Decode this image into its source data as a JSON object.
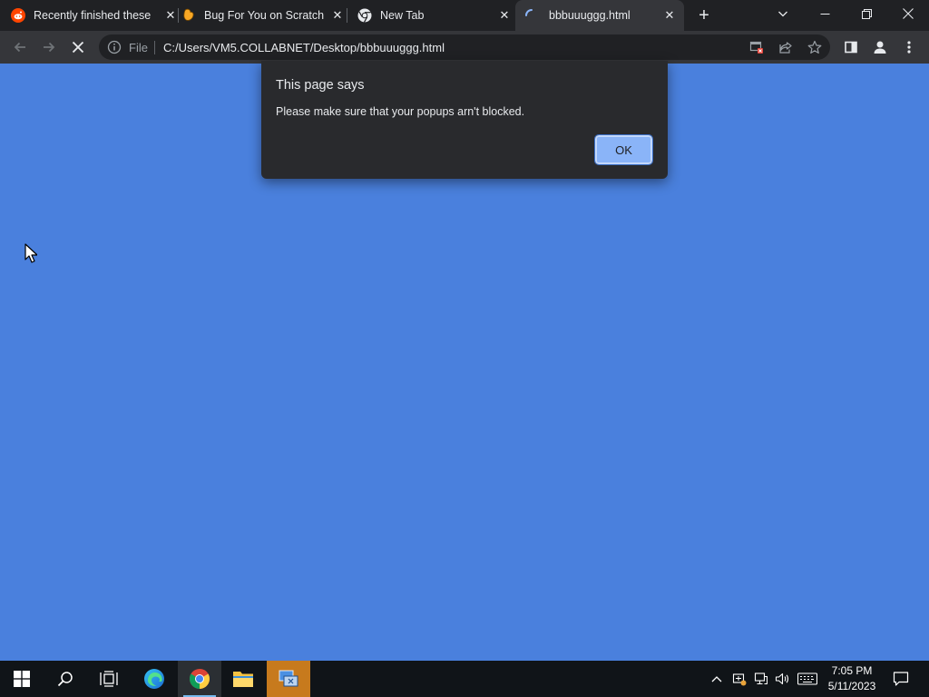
{
  "browser": {
    "tabs": [
      {
        "title": "Recently finished these",
        "favicon": "reddit-icon",
        "close": "✕"
      },
      {
        "title": "Bug For You on Scratch",
        "favicon": "scratch-icon",
        "close": "✕"
      },
      {
        "title": "New Tab",
        "favicon": "chrome-icon",
        "close": "✕"
      },
      {
        "title": "bbbuuuggg.html",
        "favicon": "loading-spinner-icon",
        "close": "✕",
        "active": true
      }
    ],
    "new_tab_label": "+",
    "window_controls": {
      "tab_search": "⌄",
      "minimize": "—",
      "restore": "❐",
      "close": "✕"
    },
    "toolbar": {
      "back_icon": "arrow-left-icon",
      "forward_icon": "arrow-right-icon",
      "stop_icon": "stop-loading-icon",
      "scheme_label": "File",
      "url": "C:/Users/VM5.COLLABNET/Desktop/bbbuuuggg.html"
    }
  },
  "page": {
    "background_color": "#4a80dd"
  },
  "dialog": {
    "title": "This page says",
    "message": "Please make sure that your popups arn't blocked.",
    "ok_label": "OK"
  },
  "taskbar": {
    "time": "7:05 PM",
    "date": "5/11/2023",
    "accent_color": "#76b9ed"
  }
}
